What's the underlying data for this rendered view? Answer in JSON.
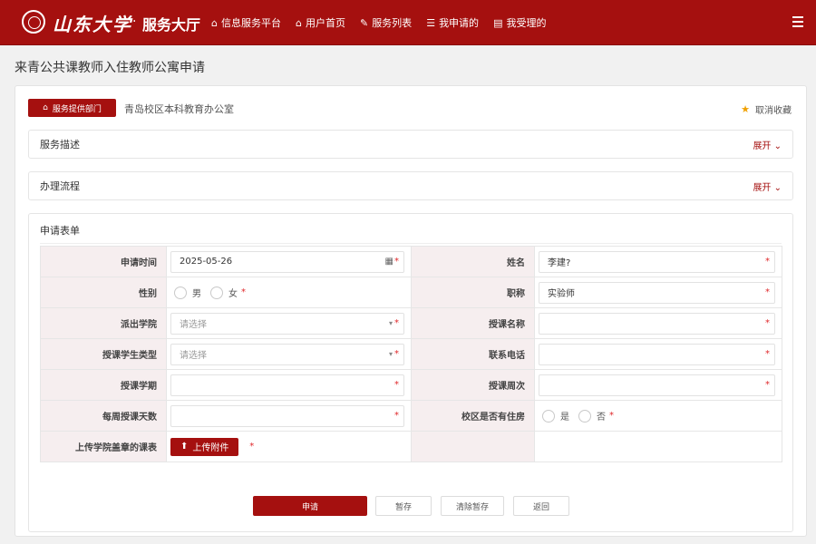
{
  "nav": {
    "logo_text": "山东大学",
    "dot": "·",
    "hall_title": "服务大厅",
    "links": [
      {
        "icon": "home-icon",
        "glyph": "⌂",
        "label": "信息服务平台"
      },
      {
        "icon": "home-icon",
        "glyph": "⌂",
        "label": "用户首页"
      },
      {
        "icon": "edit-icon",
        "glyph": "✎",
        "label": "服务列表"
      },
      {
        "icon": "list-icon",
        "glyph": "☰",
        "label": "我申请的"
      },
      {
        "icon": "inbox-icon",
        "glyph": "▤",
        "label": "我受理的"
      }
    ]
  },
  "page": {
    "title": "来青公共课教师入住教师公寓申请"
  },
  "dept": {
    "badge_label": "服务提供部门",
    "badge_glyph": "⌂",
    "name": "青岛校区本科教育办公室"
  },
  "favorite": {
    "star": "★",
    "label": "取消收藏"
  },
  "sections": {
    "description": {
      "title": "服务描述",
      "expand": "展开 ⌄"
    },
    "process": {
      "title": "办理流程",
      "expand": "展开 ⌄"
    }
  },
  "form": {
    "title": "申请表单",
    "required_mark": "*",
    "labels": {
      "apply_time": "申请时间",
      "name": "姓名",
      "gender": "性别",
      "title": "职称",
      "college": "派出学院",
      "course_name": "授课名称",
      "student_type": "授课学生类型",
      "phone": "联系电话",
      "semester": "授课学期",
      "weeks": "授课周次",
      "days_per_week": "每周授课天数",
      "has_housing": "校区是否有住房",
      "upload_schedule": "上传学院盖章的课表"
    },
    "values": {
      "apply_time": "2025-05-26",
      "name": "李建?",
      "title": "实验师",
      "course_name": "",
      "phone": "",
      "semester": "",
      "weeks": "",
      "days_per_week": ""
    },
    "placeholders": {
      "college": "请选择",
      "student_type": "请选择"
    },
    "gender_options": [
      "男",
      "女"
    ],
    "housing_options": [
      "是",
      "否"
    ],
    "calendar_glyph": "▦",
    "dropdown_glyph": "▾",
    "upload_button": "上传附件",
    "upload_glyph": "⬆"
  },
  "actions": {
    "submit": "申请",
    "save_draft": "暂存",
    "clear_draft": "清除暂存",
    "back": "返回"
  },
  "colors": {
    "brand": "#a5100f",
    "required": "#e0282b",
    "star": "#f0a000",
    "label_bg": "#f6eeef"
  }
}
